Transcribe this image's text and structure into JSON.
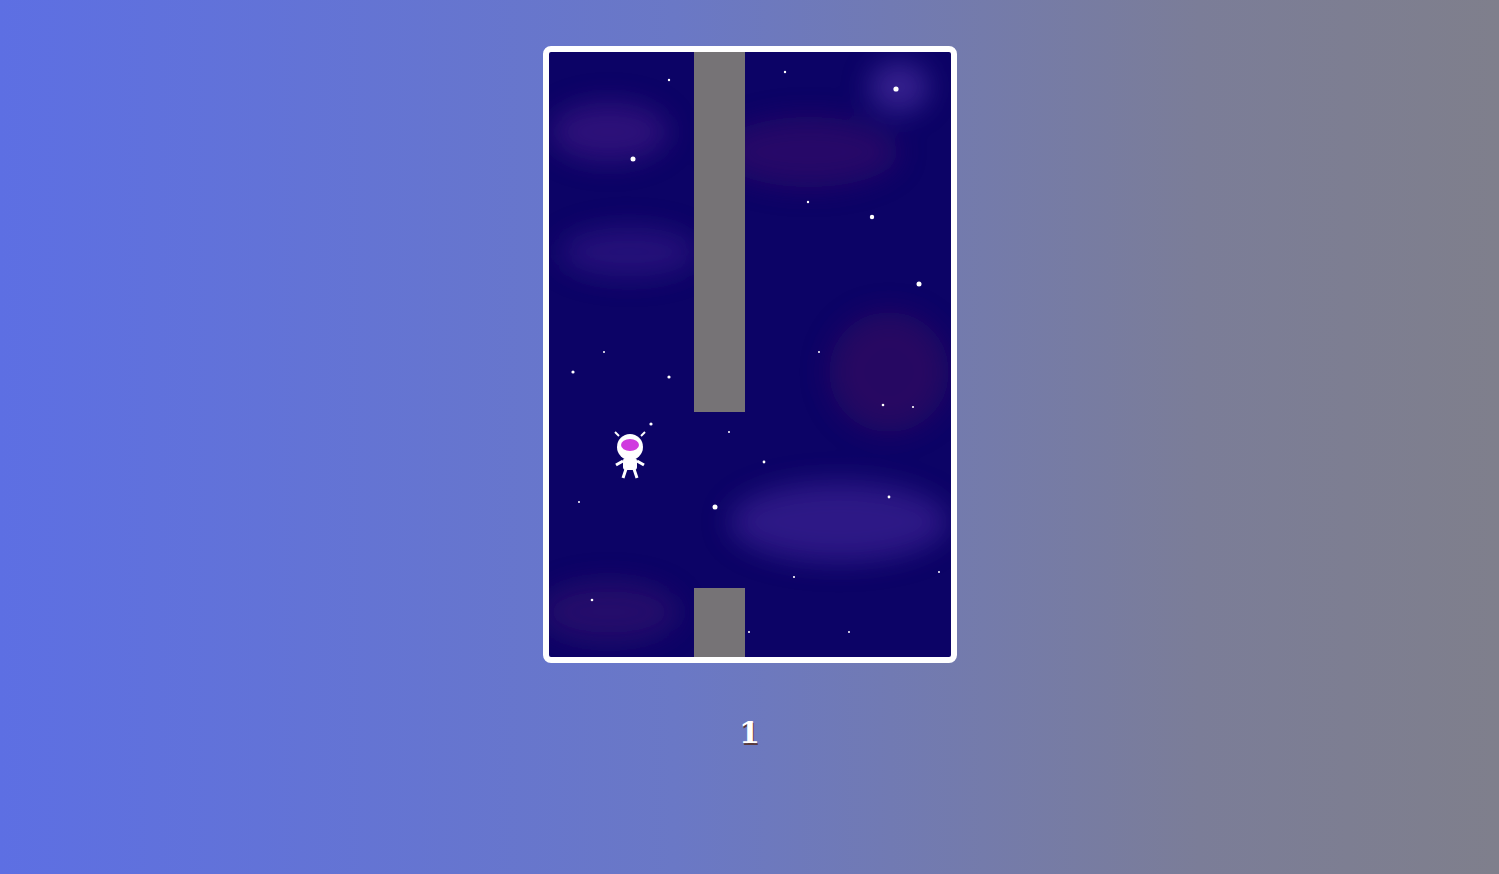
{
  "score": "1"
}
